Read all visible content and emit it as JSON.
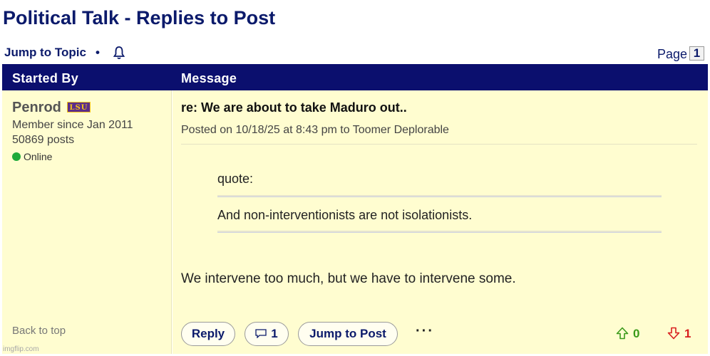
{
  "page": {
    "title": "Political Talk - Replies to Post"
  },
  "topbar": {
    "jump_to_topic": "Jump to Topic",
    "separator": "•",
    "page_label": "Page",
    "page_number": "1"
  },
  "table_header": {
    "started_by": "Started By",
    "message": "Message"
  },
  "author": {
    "username": "Penrod",
    "badge": "LSU",
    "member_since": "Member since Jan 2011",
    "posts": "50869 posts",
    "status": "Online",
    "back_to_top": "Back to top"
  },
  "post": {
    "title": "re: We are about to take Maduro out..",
    "meta": "Posted on 10/18/25 at 8:43 pm to Toomer Deplorable",
    "quote_label": "quote:",
    "quote_text": "And non-interventionists are not isolationists.",
    "body": "We intervene too much, but we have to intervene some."
  },
  "actions": {
    "reply": "Reply",
    "comment_count": "1",
    "jump_to_post": "Jump to Post",
    "more": "···",
    "upvotes": "0",
    "downvotes": "1"
  },
  "colors": {
    "header_bg": "#0b0f6e",
    "title_color": "#0b1a6b",
    "post_bg": "#fffdd0",
    "online": "#1faa3b",
    "upvote": "#3a9a1a",
    "downvote": "#d81e1e"
  },
  "icons": {
    "notify": "bell-icon",
    "status": "online-dot-icon",
    "comment": "comment-icon",
    "up": "arrow-up-icon",
    "down": "arrow-down-icon"
  },
  "watermark": "imgflip.com"
}
